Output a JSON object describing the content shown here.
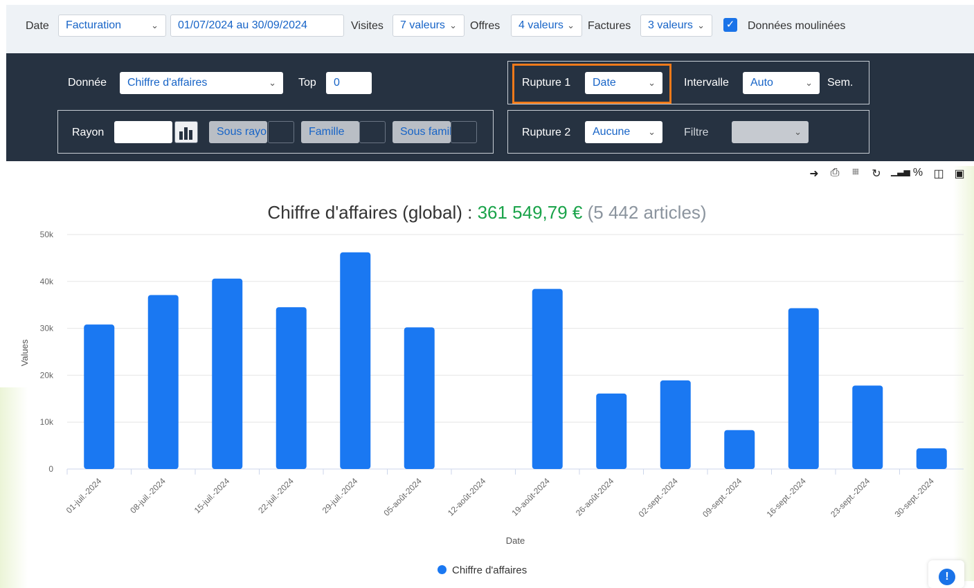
{
  "filters": {
    "date_label": "Date",
    "date_type": "Facturation",
    "date_range": "01/07/2024 au 30/09/2024",
    "visites_label": "Visites",
    "visites_value": "7 valeurs",
    "offres_label": "Offres",
    "offres_value": "4 valeurs",
    "factures_label": "Factures",
    "factures_value": "3 valeurs",
    "checkbox_checked": true,
    "checkbox_label": "Données moulinées"
  },
  "panel": {
    "donnee_label": "Donnée",
    "donnee_value": "Chiffre d'affaires",
    "top_label": "Top",
    "top_value": "0",
    "rupture1_label": "Rupture 1",
    "rupture1_value": "Date",
    "intervalle_label": "Intervalle",
    "intervalle_value": "Auto",
    "intervalle_unit": "Sem.",
    "rayon_label": "Rayon",
    "sous_rayon_placeholder": "Sous rayon",
    "famille_placeholder": "Famille",
    "sous_famille_placeholder": "Sous famille",
    "rupture2_label": "Rupture 2",
    "rupture2_value": "Aucune",
    "filtre_label": "Filtre"
  },
  "chart_heading": {
    "prefix": "Chiffre d'affaires (global) : ",
    "amount": "361 549,79 €",
    "suffix": " (5 442 articles)"
  },
  "colors": {
    "bar": "#1a78f2",
    "amount": "#1aa34a",
    "highlight": "#f07a1a",
    "panel": "#263241"
  },
  "chart_data": {
    "type": "bar",
    "categories": [
      "01-juil.-2024",
      "08-juil.-2024",
      "15-juil.-2024",
      "22-juil.-2024",
      "29-juil.-2024",
      "05-août-2024",
      "12-août-2024",
      "19-août-2024",
      "26-août-2024",
      "02-sept.-2024",
      "09-sept.-2024",
      "16-sept.-2024",
      "23-sept.-2024",
      "30-sept.-2024"
    ],
    "series": [
      {
        "name": "Chiffre d'affaires",
        "values": [
          30800,
          37100,
          40600,
          34500,
          46200,
          30200,
          0,
          38400,
          16100,
          18900,
          8300,
          34300,
          17800,
          4400
        ]
      }
    ],
    "yticks": [
      "0",
      "10k",
      "20k",
      "30k",
      "40k",
      "50k"
    ],
    "ylim": [
      0,
      50000
    ],
    "xlabel": "Date",
    "ylabel": "Values",
    "grid": true,
    "legend": "bottom"
  }
}
